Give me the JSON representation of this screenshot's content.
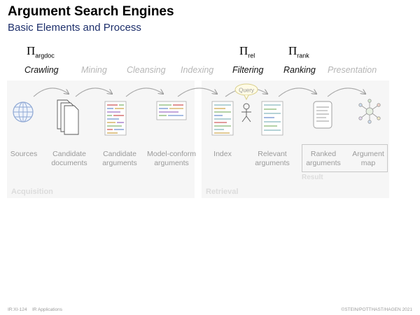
{
  "header": {
    "title": "Argument Search Engines",
    "subtitle": "Basic Elements and Process"
  },
  "pi_labels": [
    {
      "symbol": "Π",
      "sub": "argdoc"
    },
    {
      "symbol": "Π",
      "sub": "rel"
    },
    {
      "symbol": "Π",
      "sub": "rank"
    }
  ],
  "steps": [
    "Crawling",
    "Mining",
    "Cleansing",
    "Indexing",
    "Filtering",
    "Ranking",
    "Presentation"
  ],
  "items": [
    "Sources",
    "Candidate documents",
    "Candidate arguments",
    "Model-conform arguments",
    "Index",
    "Relevant arguments",
    "Ranked arguments",
    "Argument map"
  ],
  "item_lines": [
    [
      "Sources"
    ],
    [
      "Candidate",
      "documents"
    ],
    [
      "Candidate",
      "arguments"
    ],
    [
      "Model-conform",
      "arguments"
    ],
    [
      "Index"
    ],
    [
      "Relevant",
      "arguments"
    ],
    [
      "Ranked",
      "arguments"
    ],
    [
      "Argument",
      "map"
    ]
  ],
  "query_label": "Query",
  "groups": {
    "acquisition": "Acquisition",
    "retrieval": "Retrieval",
    "result": "Result"
  },
  "footer": {
    "left_code": "IR:XI-124",
    "left_topic": "IR Applications",
    "right": "©STEIN/POTTHAST/HAGEN 2021"
  },
  "colors": {
    "subtitle": "#1d2f6b",
    "active_step": "#111111",
    "inactive_step": "#b6b6b6",
    "query_bubble": "#d9cf8a"
  }
}
